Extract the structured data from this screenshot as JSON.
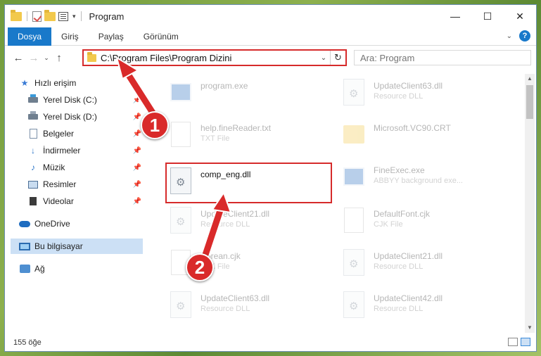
{
  "window": {
    "title": "Program",
    "controls": {
      "minimize": "—",
      "maximize": "☐",
      "close": "✕"
    }
  },
  "ribbon": {
    "tabs": [
      {
        "label": "Dosya",
        "active": true
      },
      {
        "label": "Giriş",
        "active": false
      },
      {
        "label": "Paylaş",
        "active": false
      },
      {
        "label": "Görünüm",
        "active": false
      }
    ],
    "help": "?"
  },
  "navigation": {
    "back": "←",
    "forward": "→",
    "recent": "⌄",
    "up": "↑",
    "address": "C:\\Program Files\\Program Dizini",
    "refresh": "↻",
    "search_placeholder": "Ara: Program"
  },
  "sidebar": {
    "items": [
      {
        "label": "Hızlı erişim",
        "icon": "star-icon",
        "pinned": false
      },
      {
        "label": "Yerel Disk (C:)",
        "icon": "disk-icon",
        "pinned": true
      },
      {
        "label": "Yerel Disk (D:)",
        "icon": "disk-icon",
        "pinned": true
      },
      {
        "label": "Belgeler",
        "icon": "documents-icon",
        "pinned": true
      },
      {
        "label": "İndirmeler",
        "icon": "downloads-icon",
        "pinned": true
      },
      {
        "label": "Müzik",
        "icon": "music-icon",
        "pinned": true
      },
      {
        "label": "Resimler",
        "icon": "pictures-icon",
        "pinned": true
      },
      {
        "label": "Videolar",
        "icon": "videos-icon",
        "pinned": true
      },
      {
        "label": "OneDrive",
        "icon": "cloud-icon",
        "pinned": false
      },
      {
        "label": "Bu bilgisayar",
        "icon": "computer-icon",
        "pinned": false,
        "selected": true
      },
      {
        "label": "Ağ",
        "icon": "network-icon",
        "pinned": false
      }
    ]
  },
  "files": [
    {
      "name": "program.exe",
      "type": "",
      "icon": "exe-icon",
      "faded": true
    },
    {
      "name": "UpdateClient63.dll",
      "type": "Resource DLL",
      "icon": "dll-icon",
      "faded": true
    },
    {
      "name": "help.fineReader.txt",
      "type": "TXT File",
      "icon": "txt-icon",
      "faded": true
    },
    {
      "name": "Microsoft.VC90.CRT",
      "type": "",
      "icon": "folder-icon",
      "faded": true
    },
    {
      "name": "comp_eng.dll",
      "type": "",
      "icon": "dll-icon",
      "faded": false,
      "highlighted": true
    },
    {
      "name": "FineExec.exe",
      "type": "ABBYY background exe...",
      "icon": "exe-icon",
      "faded": true
    },
    {
      "name": "UpdateClient21.dll",
      "type": "Resource DLL",
      "icon": "dll-icon",
      "faded": true
    },
    {
      "name": "DefaultFont.cjk",
      "type": "CJK File",
      "icon": "txt-icon",
      "faded": true
    },
    {
      "name": "Korean.cjk",
      "type": "CJK File",
      "icon": "txt-icon",
      "faded": true
    },
    {
      "name": "UpdateClient21.dll",
      "type": "Resource DLL",
      "icon": "dll-icon",
      "faded": true
    },
    {
      "name": "UpdateClient63.dll",
      "type": "Resource DLL",
      "icon": "dll-icon",
      "faded": true
    },
    {
      "name": "UpdateClient42.dll",
      "type": "Resource DLL",
      "icon": "dll-icon",
      "faded": true
    }
  ],
  "status": {
    "item_count": "155 öğe"
  },
  "annotations": {
    "step1": "1",
    "step2": "2",
    "color": "#d92a2a"
  }
}
